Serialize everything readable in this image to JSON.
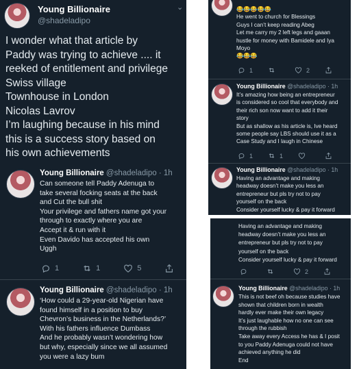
{
  "author": {
    "name": "Young Billionaire",
    "handle": "@shadeladipo",
    "time": "1h"
  },
  "colors": {
    "background": "#15202b",
    "text": "#e6ecf0",
    "muted": "#8899a6",
    "divider": "#38444d"
  },
  "panel_a": {
    "text": "I wonder what that article by\nPaddy was trying to achieve .... it\nreeked of entitlement and privilege\nSwiss village\nTownhouse in London\nNicolas Lavrov\nI’m laughing because in his mind\nthis is a success story based on\nhis own achievements"
  },
  "panel_b": {
    "tweet1": {
      "text": "Can someone tell Paddy Adenuga to\ntake several focking seats at the back\nand Cut the bull shit\nYour privilege and fathers name got your\nthrough to exactly where you are\nAccept it & run with it\nEven Davido has accepted his own\nUggh",
      "replies": "1",
      "retweets": "1",
      "likes": "5"
    },
    "tweet2": {
      "text": "‘How could a 29-year-old Nigerian have\nfound himself in a position to buy\nChevron’s business in the Netherlands?’\nWith his fathers influence Dumbass\nAnd he probably wasn’t wondering how\nbut why, especially since we all assumed\nyou were a lazy bum"
    }
  },
  "panel_c": {
    "tweet1": {
      "text": "😂😂😂😂😂\nHe went to church for Blessings\nGuys I can’t keep reading Abeg\nLet me carry my 2 left legs and gaaan\nhustle for money with Bamidele and Iya\nMoyo\n😂😂😂",
      "replies": "1",
      "retweets": "",
      "likes": "2"
    },
    "tweet2": {
      "text": "It’s amazing how being an entrepreneur\nis considered so cool that everybody and\ntheir rich son now want to add it their\nstory\nBut as shallow as his article is, Ive heard\nsome people say LBS should use it as a\nCase Study and I laugh in Chinese",
      "replies": "1",
      "retweets": "1",
      "likes": ""
    },
    "tweet3": {
      "text": "Having an advantage and making\nheadway doesn’t make you less an\nentrepreneur but pls try not to pay\nyourself on the back\nConsider yourself lucky & pay it forward"
    }
  },
  "panel_d": {
    "continued": {
      "text": "Having an advantage and making\nheadway doesn’t make you less an\nentrepreneur but pls try not to pay\nyourself on the back\nConsider yourself lucky & pay it forward",
      "replies": "",
      "retweets": "",
      "likes": "2"
    },
    "tweet": {
      "text": "This is not beef oh because studies have\nshown that children born in wealth\nhardly ever make their own legacy\nIt’s just laughable how no one can see\nthrough the rubbish\nTake away every Access he has & I posit\nto you Paddy Adenuga could not have\nachieved anything he did\nEnd"
    }
  }
}
